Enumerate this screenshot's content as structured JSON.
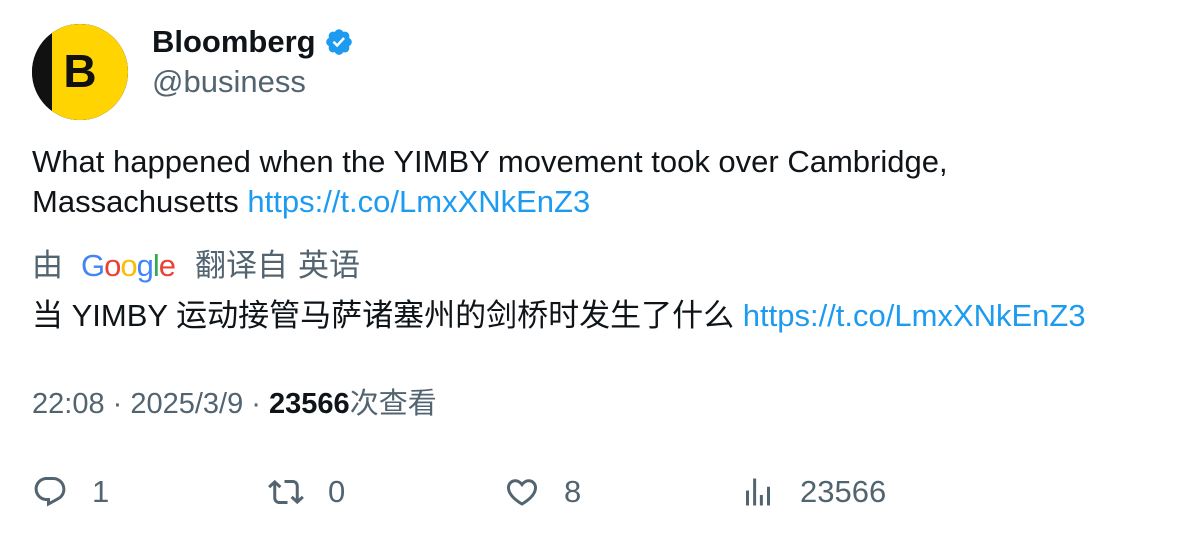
{
  "author": {
    "display_name": "Bloomberg",
    "handle": "@business",
    "avatar_letter": "B",
    "verified_icon": "verified-badge-icon"
  },
  "tweet": {
    "text_line1": "What happened when the YIMBY movement took over Cambridge,",
    "text_line2": "Massachusetts ",
    "link": "https://t.co/LmxXNkEnZ3"
  },
  "translation": {
    "by": "由",
    "provider": "Google",
    "label": "翻译自",
    "language": "英语",
    "text": "当 YIMBY 运动接管马萨诸塞州的剑桥时发生了什么 ",
    "link": "https://t.co/LmxXNkEnZ3"
  },
  "meta": {
    "time": "22:08",
    "separator": " · ",
    "date": "2025/3/9",
    "views_count": "23566",
    "views_label": "次查看"
  },
  "actions": {
    "reply_count": "1",
    "retweet_count": "0",
    "like_count": "8",
    "views_count": "23566"
  },
  "colors": {
    "link": "#1d9bf0",
    "secondary_text": "#536471",
    "primary_text": "#0f1419",
    "avatar_yellow": "#ffd400",
    "verified_blue": "#1d9bf0"
  }
}
